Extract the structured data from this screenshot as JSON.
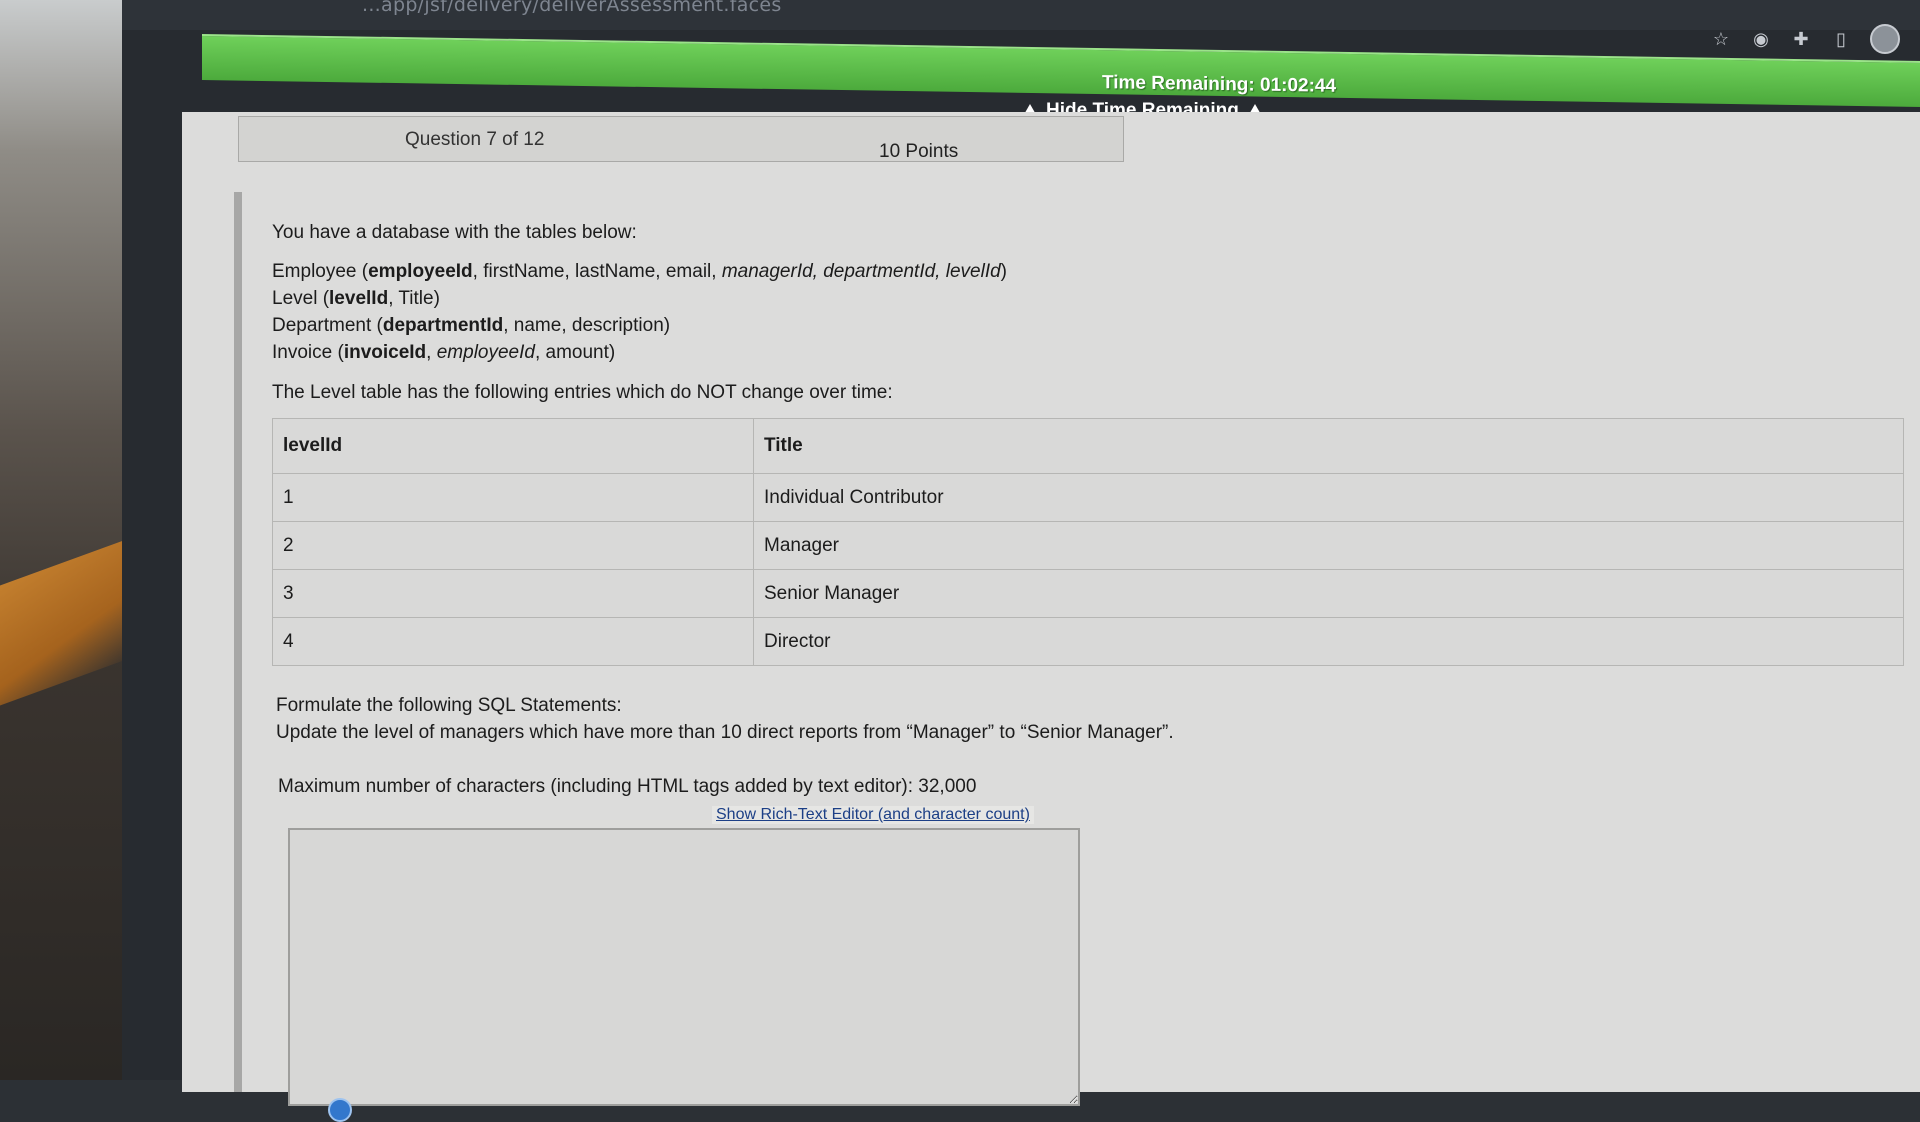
{
  "browser": {
    "url": "...app/jsf/delivery/deliverAssessment.faces"
  },
  "timer": {
    "label": "Time Remaining: 01:02:44",
    "toggle": "Hide Time Remaining",
    "color": "#4caa3c"
  },
  "question": {
    "number": "Question 7 of 12",
    "points": "10 Points",
    "intro": "You have a database with the tables below:",
    "schema": {
      "employee": {
        "prefix": "Employee (",
        "key": "employeeId",
        "plain": ", firstName, lastName, email, ",
        "fk": "managerId, departmentId, levelId",
        "suffix": ")"
      },
      "level": {
        "prefix": "Level (",
        "key": "levelId",
        "plain": ", Title)"
      },
      "department": {
        "prefix": "Department (",
        "key": "departmentId",
        "plain": ", name, description)"
      },
      "invoice": {
        "prefix": "Invoice (",
        "key": "invoiceId",
        "mid": ", ",
        "fk": "employeeId",
        "suffix": ", amount)"
      }
    },
    "level_note": "The Level table has the following entries which do NOT change over time:",
    "table": {
      "headers": [
        "levelId",
        "Title"
      ],
      "rows": [
        [
          "1",
          "Individual Contributor"
        ],
        [
          "2",
          "Manager"
        ],
        [
          "3",
          "Senior Manager"
        ],
        [
          "4",
          "Director"
        ]
      ]
    },
    "task_title": "Formulate the following SQL Statements:",
    "task_body": "Update the level of managers which have more than 10 direct reports from “Manager” to “Senior Manager”.",
    "max_chars": "Maximum number of characters (including HTML tags added by text editor): 32,000",
    "editor_link": "Show Rich-Text Editor (and character count)"
  }
}
